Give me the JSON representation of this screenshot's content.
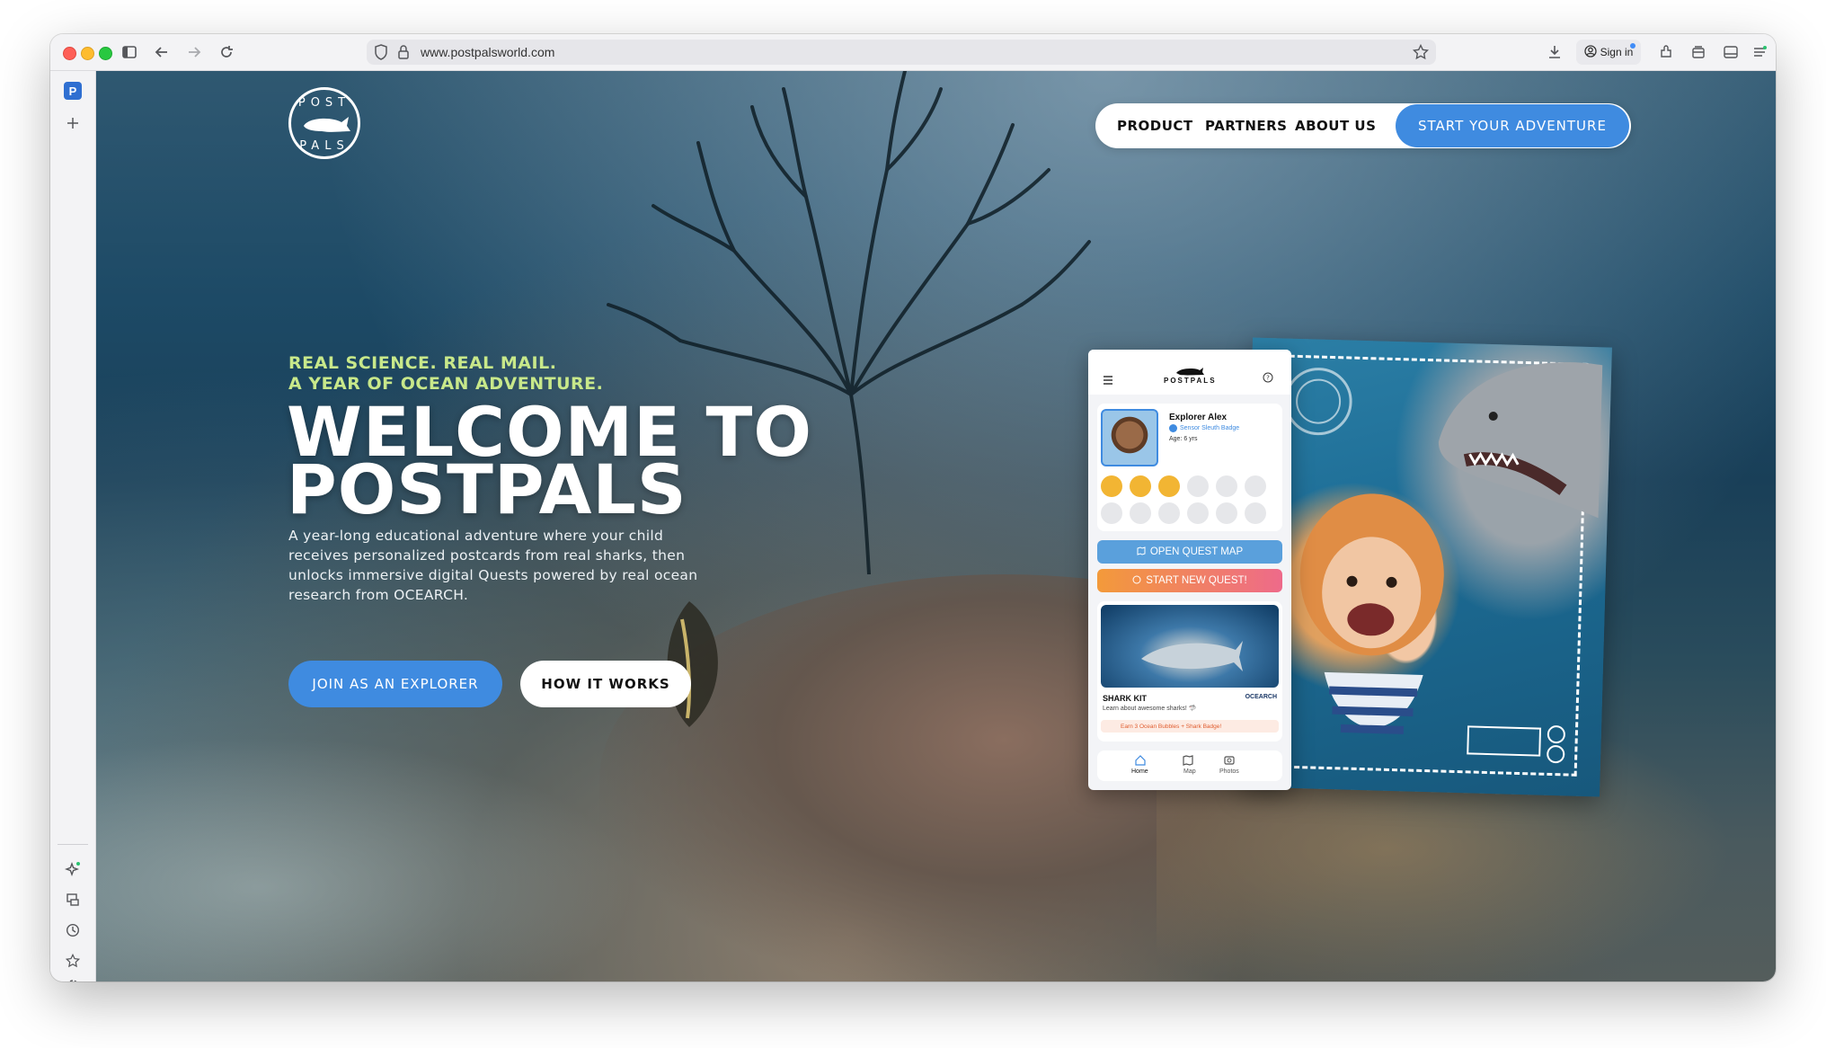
{
  "browser": {
    "url": "www.postpalsworld.com",
    "sign_in_label": "Sign in",
    "sidebar_favicon_letter": "P"
  },
  "site": {
    "logo_letters": "POST PALS",
    "nav": {
      "product": "PRODUCT",
      "partners": "PARTNERS",
      "about": "ABOUT US",
      "cta": "START YOUR ADVENTURE"
    },
    "hero": {
      "tagline_line1": "REAL SCIENCE. REAL MAIL.",
      "tagline_line2": "A YEAR OF OCEAN ADVENTURE.",
      "title_line1": "WELCOME TO",
      "title_line2": "POSTPALS",
      "description": "A year-long educational adventure where your child receives personalized postcards from real sharks, then unlocks immersive digital Quests powered by real ocean research from OCEARCH.",
      "join_button": "JOIN AS AN EXPLORER",
      "how_button": "HOW IT WORKS"
    }
  },
  "app_mockup": {
    "brand": "POSTPALS",
    "explorer_name": "Explorer Alex",
    "badge": "Sensor Sleuth Badge",
    "age": "Age: 6 yrs",
    "open_map": "OPEN QUEST MAP",
    "start_quest": "START NEW QUEST!",
    "kit_title": "SHARK KIT",
    "kit_desc": "Learn about awesome sharks! 🦈",
    "kit_partner": "OCEARCH",
    "earn_text": "Earn 3 Ocean Bubbles + Shark Badge!",
    "tabs": {
      "home": "Home",
      "map": "Map",
      "photos": "Photos"
    }
  },
  "colors": {
    "accent_blue": "#3f8be0",
    "tagline_green": "#c8e88a",
    "quest_orange": "#f39a3a"
  }
}
